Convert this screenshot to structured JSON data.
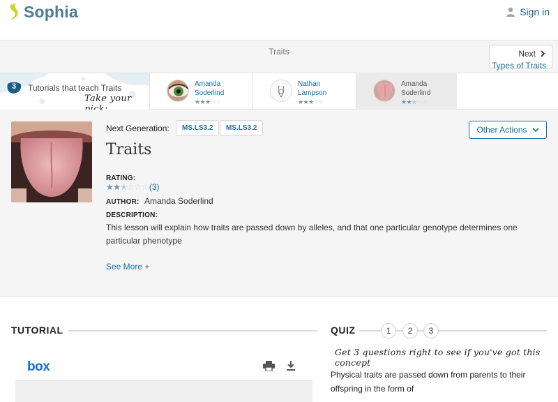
{
  "colors": {
    "brand": "#4e7c94",
    "link": "#1a6ea0",
    "logo_leaf": "#c8d72b"
  },
  "header": {
    "logo_text": "Sophia",
    "logo_tm": ".",
    "signin_label": "Sign in",
    "user_icon": "user-icon"
  },
  "breadcrumb": {
    "title": "Traits",
    "next_label": "Next",
    "next_title": "Types of Traits"
  },
  "picker": {
    "count": "3",
    "label": "Tutorials that teach Traits",
    "handwritten": "Take your pick:",
    "tutorials": [
      {
        "name_line1": "Amanda",
        "name_line2": "Soderlind",
        "rating": 3
      },
      {
        "name_line1": "Nathan",
        "name_line2": "Lampson",
        "rating": 3
      },
      {
        "name_line1": "Amanda",
        "name_line2": "Soderlind",
        "rating": 2.5
      }
    ]
  },
  "details": {
    "next_generation_label": "Next Generation:",
    "standards": [
      "MS.LS3.2",
      "MS.LS3.2"
    ],
    "title": "Traits",
    "other_actions": "Other Actions",
    "rating_label": "RATING:",
    "rating_value": 2.5,
    "rating_count": "(3)",
    "author_label": "AUTHOR:",
    "author_name": "Amanda Soderlind",
    "description_label": "DESCRIPTION:",
    "description": "This lesson will explain how traits are passed down by alleles, and that one particular genotype determines one particular phenotype",
    "see_more": "See More +"
  },
  "tutorial": {
    "heading": "TUTORIAL",
    "viewer_logo": "box",
    "icons": [
      "print-icon",
      "download-icon"
    ]
  },
  "quiz": {
    "heading": "QUIZ",
    "questions": [
      "1",
      "2",
      "3"
    ],
    "hint": "Get 3 questions right to see if you've got this concept",
    "question_text": "Physical traits are passed down from parents to their offspring in the form of"
  }
}
